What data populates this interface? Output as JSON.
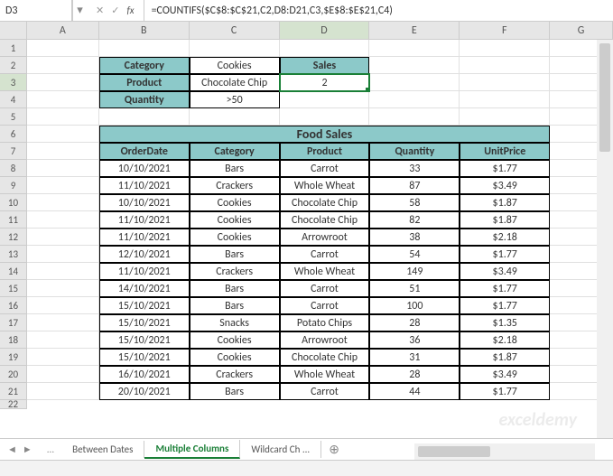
{
  "nameBox": "D3",
  "formula": "=COUNTIFS($C$8:$C$21,C2,D8:D21,C3,$E$8:$E$21,C4)",
  "columns": [
    "A",
    "B",
    "C",
    "D",
    "E",
    "F",
    "G"
  ],
  "activeCol": "D",
  "activeRow": "3",
  "criteria": {
    "b2": "Category",
    "c2": "Cookies",
    "d2": "Sales",
    "b3": "Product",
    "c3": "Chocolate Chip",
    "d3": "2",
    "b4": "Quantity",
    "c4": ">50"
  },
  "mergedTitle": "Food Sales",
  "headers": {
    "b7": "OrderDate",
    "c7": "Category",
    "d7": "Product",
    "e7": "Quantity",
    "f7": "UnitPrice"
  },
  "table": [
    {
      "d": "10/10/2021",
      "c": "Bars",
      "p": "Carrot",
      "q": "33",
      "u": "$1.77"
    },
    {
      "d": "11/10/2021",
      "c": "Crackers",
      "p": "Whole Wheat",
      "q": "87",
      "u": "$3.49"
    },
    {
      "d": "10/10/2021",
      "c": "Cookies",
      "p": "Chocolate Chip",
      "q": "58",
      "u": "$1.87"
    },
    {
      "d": "11/10/2021",
      "c": "Cookies",
      "p": "Chocolate Chip",
      "q": "82",
      "u": "$1.87"
    },
    {
      "d": "11/10/2021",
      "c": "Cookies",
      "p": "Arrowroot",
      "q": "38",
      "u": "$2.18"
    },
    {
      "d": "12/10/2021",
      "c": "Bars",
      "p": "Carrot",
      "q": "54",
      "u": "$1.77"
    },
    {
      "d": "11/10/2021",
      "c": "Crackers",
      "p": "Whole Wheat",
      "q": "149",
      "u": "$3.49"
    },
    {
      "d": "14/10/2021",
      "c": "Bars",
      "p": "Carrot",
      "q": "51",
      "u": "$1.77"
    },
    {
      "d": "15/10/2021",
      "c": "Bars",
      "p": "Carrot",
      "q": "100",
      "u": "$1.77"
    },
    {
      "d": "15/10/2021",
      "c": "Snacks",
      "p": "Potato Chips",
      "q": "28",
      "u": "$1.35"
    },
    {
      "d": "15/10/2021",
      "c": "Cookies",
      "p": "Arrowroot",
      "q": "36",
      "u": "$2.18"
    },
    {
      "d": "15/10/2021",
      "c": "Cookies",
      "p": "Chocolate Chip",
      "q": "31",
      "u": "$1.87"
    },
    {
      "d": "16/10/2021",
      "c": "Crackers",
      "p": "Whole Wheat",
      "q": "28",
      "u": "$3.49"
    },
    {
      "d": "20/10/2021",
      "c": "Bars",
      "p": "Carrot",
      "q": "44",
      "u": "$1.77"
    }
  ],
  "tabs": {
    "prev": "Between Dates",
    "active": "Multiple Columns",
    "next": "Wildcard Ch"
  },
  "watermark": "exceldemy"
}
